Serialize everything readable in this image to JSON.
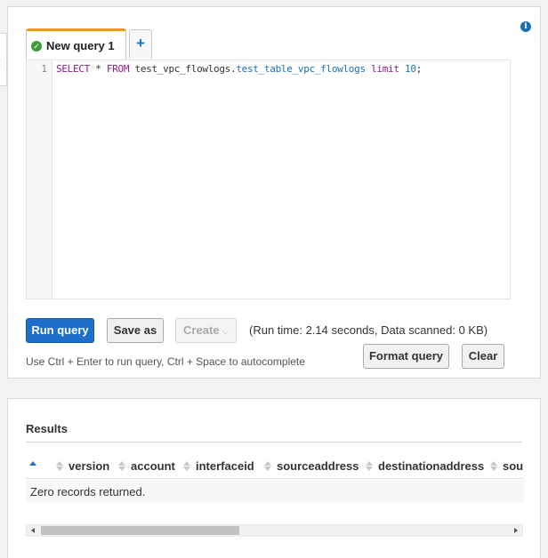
{
  "editor": {
    "tab_label": "New query 1",
    "add_tab_label": "+",
    "line_number": "1",
    "query": {
      "kw_select": "SELECT",
      "star": " * ",
      "kw_from": "FROM",
      "db": " test_vpc_flowlogs.",
      "table": "test_table_vpc_flowlogs",
      "kw_limit": " limit ",
      "limit_value": "10",
      "end": ";"
    }
  },
  "toolbar": {
    "run_label": "Run query",
    "saveas_label": "Save as",
    "create_label": "Create",
    "runtime_text": "(Run time: 2.14 seconds, Data scanned: 0 KB)",
    "hint_text": "Use Ctrl + Enter to run query, Ctrl + Space to autocomplete",
    "format_label": "Format query",
    "clear_label": "Clear"
  },
  "results": {
    "title": "Results",
    "columns": [
      "version",
      "account",
      "interfaceid",
      "sourceaddress",
      "destinationaddress",
      "sou"
    ],
    "empty_message": "Zero records returned."
  },
  "icons": {
    "info": "info-icon",
    "success": "check-circle-icon",
    "add": "plus-icon",
    "dropdown": "chevron-down-icon"
  },
  "colors": {
    "primary_button": "#1d6fc9",
    "active_tab_accent": "#ec9a1e",
    "success": "#3c9c3c",
    "keyword": "#8b1a8b",
    "identifier": "#1a6fb3"
  }
}
